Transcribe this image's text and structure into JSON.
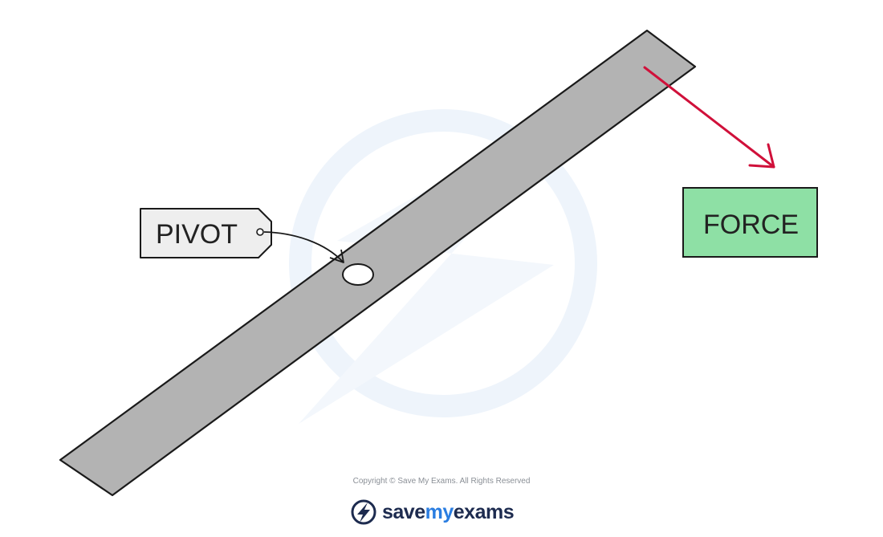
{
  "diagram": {
    "pivot_label": "PIVOT",
    "force_label": "FORCE"
  },
  "footer": {
    "copyright": "Copyright © Save My Exams. All Rights Reserved",
    "brand": {
      "word_a": "save",
      "word_b": "my",
      "word_c": "exams"
    }
  },
  "colors": {
    "bar_fill": "#b3b3b3",
    "bar_outline": "#1a1a1a",
    "force_arrow": "#d0103a",
    "force_box_fill": "#8ee0a5",
    "pivot_tag_fill": "#eeeeee",
    "watermark": "#eef4fb",
    "brand_dark": "#1d2b4f",
    "brand_blue": "#2a7de1"
  },
  "icons": {
    "brand_logo": "lightning-bolt-circle-icon",
    "watermark": "save-my-exams-watermark"
  }
}
